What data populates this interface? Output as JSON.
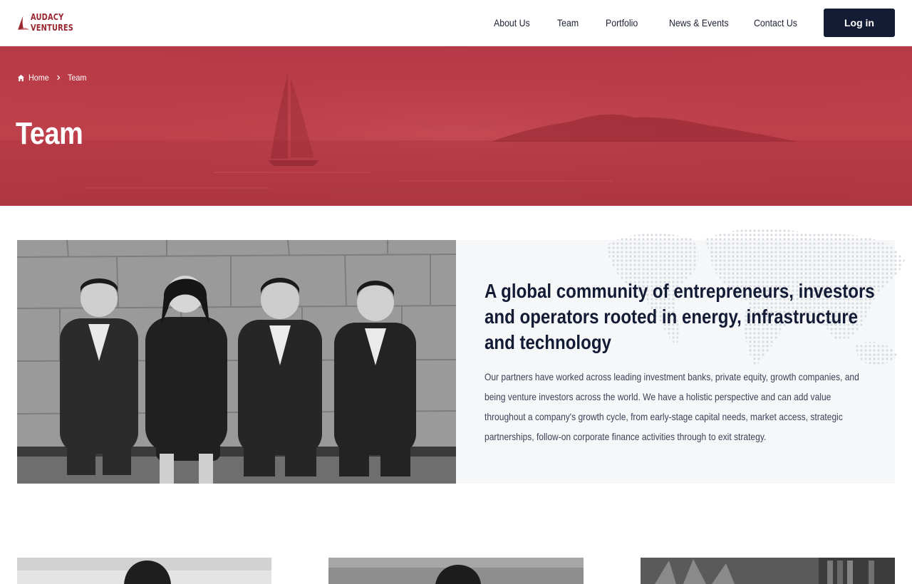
{
  "brand": {
    "line1": "AUDACY",
    "line2": "VENTURES",
    "color": "#9a2630"
  },
  "nav": {
    "items": [
      "About Us",
      "Team",
      "Portfolio",
      "News & Events",
      "Contact Us"
    ],
    "login_label": "Log in"
  },
  "breadcrumb": {
    "home": "Home",
    "current": "Team"
  },
  "hero": {
    "title": "Team",
    "tint": "#bd3f4a"
  },
  "intro": {
    "heading": "A global community of entrepreneurs, investors and operators rooted in energy, infrastructure and technology",
    "body": "Our partners have worked across leading investment banks, private equity, growth companies, and being venture investors across the world. We have a holistic perspective and can add value throughout a company's growth cycle, from early-stage capital needs, market access, strategic partnerships, follow-on corporate finance activities through to exit strategy."
  },
  "colors": {
    "navy": "#131b35",
    "card_bg": "#f6f7f9"
  }
}
